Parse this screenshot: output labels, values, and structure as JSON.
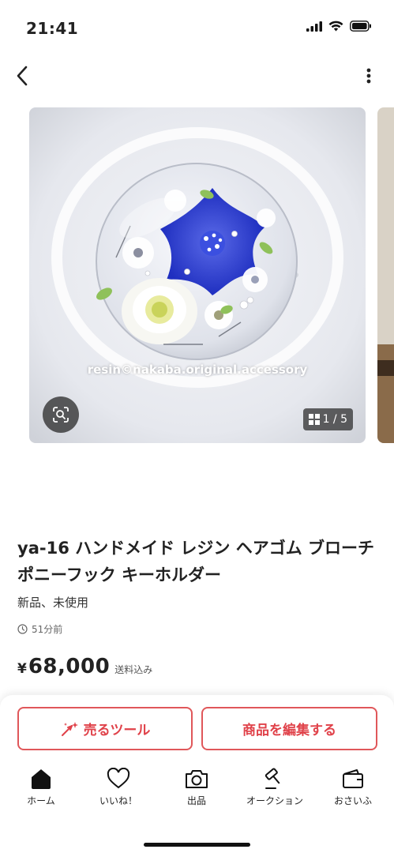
{
  "status": {
    "time": "21:41"
  },
  "gallery": {
    "watermark": "resin©nakaba.original.accessory",
    "counter": "1 / 5"
  },
  "item": {
    "title": "ya-16 ハンドメイド レジン ヘアゴム ブローチ ポニーフック キーホルダー",
    "condition": "新品、未使用",
    "posted": "51分前",
    "price_mark": "¥",
    "price": "68,000",
    "shipping": "送料込み"
  },
  "actions": {
    "sell_tool": "売るツール",
    "edit_item": "商品を編集する"
  },
  "tabs": [
    {
      "label": "ホーム",
      "icon": "home-icon"
    },
    {
      "label": "いいね！",
      "icon": "heart-icon"
    },
    {
      "label": "出品",
      "icon": "camera-icon"
    },
    {
      "label": "オークション",
      "icon": "gavel-icon"
    },
    {
      "label": "おさいふ",
      "icon": "wallet-icon"
    }
  ],
  "colors": {
    "accent": "#e0424a",
    "text": "#222222"
  }
}
